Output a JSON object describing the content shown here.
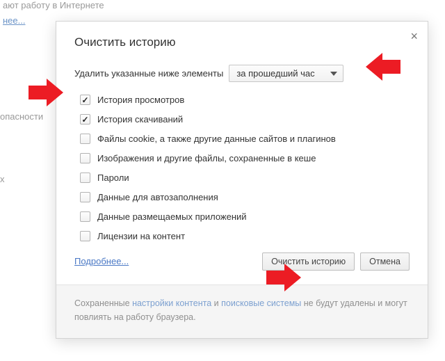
{
  "background": {
    "line1": "ают работу в Интернете",
    "link1": "нее...",
    "line2": "опасности",
    "line3": "x"
  },
  "dialog": {
    "title": "Очистить историю",
    "close_glyph": "×",
    "subtitle": "Удалить указанные ниже элементы",
    "select_value": "за прошедший час",
    "items": [
      {
        "label": "История просмотров",
        "checked": true
      },
      {
        "label": "История скачиваний",
        "checked": true
      },
      {
        "label": "Файлы cookie, а также другие данные сайтов и плагинов",
        "checked": false
      },
      {
        "label": "Изображения и другие файлы, сохраненные в кеше",
        "checked": false
      },
      {
        "label": "Пароли",
        "checked": false
      },
      {
        "label": "Данные для автозаполнения",
        "checked": false
      },
      {
        "label": "Данные размещаемых приложений",
        "checked": false
      },
      {
        "label": "Лицензии на контент",
        "checked": false
      }
    ],
    "more_link": "Подробнее...",
    "primary_btn": "Очистить историю",
    "cancel_btn": "Отмена",
    "footer": {
      "pre": "Сохраненные ",
      "link1": "настройки контента",
      "mid": " и ",
      "link2": "поисковые системы",
      "post": " не будут удалены и могут повлиять на работу браузера."
    }
  },
  "annotations": {
    "arrow1_name": "red-arrow-left",
    "arrow2_name": "red-arrow-right-top",
    "arrow3_name": "red-arrow-right-bottom"
  }
}
